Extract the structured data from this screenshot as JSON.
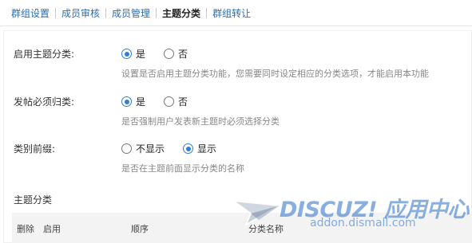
{
  "tabs": [
    {
      "label": "群组设置",
      "active": false
    },
    {
      "label": "成员审核",
      "active": false
    },
    {
      "label": "成员管理",
      "active": false
    },
    {
      "label": "主题分类",
      "active": true
    },
    {
      "label": "群组转让",
      "active": false
    }
  ],
  "settings": {
    "enable_category": {
      "label": "启用主题分类:",
      "yes": "是",
      "no": "否",
      "selected": "yes",
      "description": "设置是否启用主题分类功能，您需要同时设定相应的分类选项，才能启用本功能"
    },
    "required_category": {
      "label": "发帖必须归类:",
      "yes": "是",
      "no": "否",
      "selected": "yes",
      "description": "是否强制用户发表新主题时必须选择分类"
    },
    "prefix": {
      "label": "类别前缀:",
      "hide": "不显示",
      "show": "显示",
      "selected": "show",
      "description": "是否在主题前面显示分类的名称"
    }
  },
  "category_section": {
    "title": "主题分类",
    "columns": [
      "删除",
      "启用",
      "顺序",
      "分类名称"
    ]
  },
  "watermark": {
    "brand": "DISCUZ! 应用中心",
    "url": "addon.dismall.com"
  },
  "colors": {
    "link": "#2b6cb0",
    "radio_accent": "#2e7fd8",
    "description": "#888888",
    "table_header_bg": "#f3f3f3"
  }
}
